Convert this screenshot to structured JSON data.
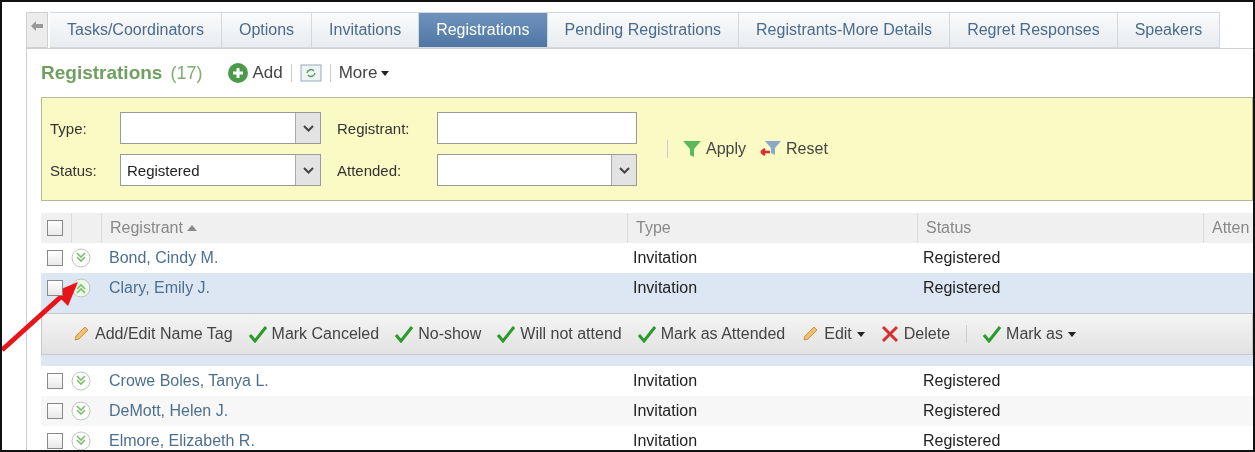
{
  "tabs": [
    {
      "label": "Tasks/Coordinators",
      "selected": false
    },
    {
      "label": "Options",
      "selected": false
    },
    {
      "label": "Invitations",
      "selected": false
    },
    {
      "label": "Registrations",
      "selected": true
    },
    {
      "label": "Pending Registrations",
      "selected": false
    },
    {
      "label": "Registrants-More Details",
      "selected": false
    },
    {
      "label": "Regret Responses",
      "selected": false
    },
    {
      "label": "Speakers",
      "selected": false
    }
  ],
  "header": {
    "title": "Registrations",
    "count": "(17)",
    "add": "Add",
    "more": "More"
  },
  "filters": [
    {
      "label": "Type:",
      "kind": "select"
    },
    {
      "label": "Registrant:",
      "kind": "text"
    },
    {
      "label": "Status:",
      "kind": "select",
      "value": "Registered"
    },
    {
      "label": "Attended:",
      "kind": "select"
    }
  ],
  "filter_buttons": {
    "apply": "Apply",
    "reset": "Reset"
  },
  "table": {
    "select_all_checked": false,
    "columns": [
      "Registrant",
      "Type",
      "Status",
      "Atten"
    ],
    "rows": [
      {
        "registrant": "Bond, Cindy M.",
        "type": "Invitation",
        "status": "Registered",
        "checked": false,
        "expanded": false
      },
      {
        "registrant": "Clary, Emily J.",
        "type": "Invitation",
        "status": "Registered",
        "checked": false,
        "expanded": true
      },
      {
        "registrant": "Crowe Boles, Tanya L.",
        "type": "Invitation",
        "status": "Registered",
        "checked": false,
        "expanded": false
      },
      {
        "registrant": "DeMott, Helen J.",
        "type": "Invitation",
        "status": "Registered",
        "checked": false,
        "expanded": false
      },
      {
        "registrant": "Elmore, Elizabeth R.",
        "type": "Invitation",
        "status": "Registered",
        "checked": false,
        "expanded": false
      }
    ]
  },
  "row_actions": [
    {
      "label": "Add/Edit Name Tag",
      "kind": "pencil",
      "dropdown": false
    },
    {
      "label": "Mark Canceled",
      "kind": "check",
      "dropdown": false
    },
    {
      "label": "No-show",
      "kind": "check",
      "dropdown": false
    },
    {
      "label": "Will not attend",
      "kind": "check",
      "dropdown": false
    },
    {
      "label": "Mark as Attended",
      "kind": "check",
      "dropdown": false
    },
    {
      "label": "Edit",
      "kind": "pencil",
      "dropdown": true
    },
    {
      "label": "Delete",
      "kind": "cross",
      "dropdown": false
    },
    {
      "label": "Mark as",
      "kind": "check",
      "dropdown": true
    }
  ]
}
